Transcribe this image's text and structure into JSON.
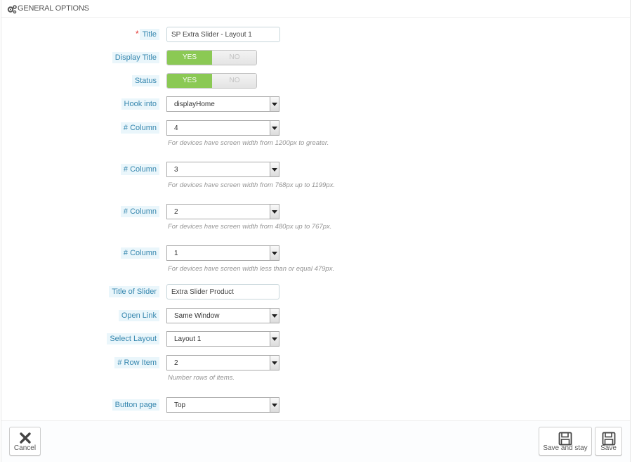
{
  "panel": {
    "heading": "General Options"
  },
  "form": {
    "title": {
      "label": "Title",
      "required_mark": "*",
      "value": "SP Extra Slider - Layout 1"
    },
    "display_title": {
      "label": "Display Title",
      "yes": "YES",
      "no": "NO",
      "selected": "yes"
    },
    "status": {
      "label": "Status",
      "yes": "YES",
      "no": "NO",
      "selected": "yes"
    },
    "hook_into": {
      "label": "Hook into",
      "value": "displayHome"
    },
    "columns": [
      {
        "label": "# Column",
        "value": "4",
        "help": "For devices have screen width from 1200px to greater."
      },
      {
        "label": "# Column",
        "value": "3",
        "help": "For devices have screen width from 768px up to 1199px."
      },
      {
        "label": "# Column",
        "value": "2",
        "help": "For devices have screen width from 480px up to 767px."
      },
      {
        "label": "# Column",
        "value": "1",
        "help": "For devices have screen width less than or equal 479px."
      }
    ],
    "title_of_slider": {
      "label": "Title of Slider",
      "value": "Extra Slider Product"
    },
    "open_link": {
      "label": "Open Link",
      "value": "Same Window"
    },
    "select_layout": {
      "label": "Select Layout",
      "value": "Layout 1"
    },
    "row_item": {
      "label": "# Row Item",
      "value": "2",
      "help": "Number rows of items."
    },
    "button_page": {
      "label": "Button page",
      "value": "Top"
    }
  },
  "footer": {
    "cancel_label": "Cancel",
    "save_and_stay_label": "Save and stay",
    "save_label": "Save"
  },
  "colors": {
    "label_bg": "#eaf6fb",
    "label_text": "#3586ae",
    "switch_on": "#8bc954",
    "required": "#e2312d"
  }
}
